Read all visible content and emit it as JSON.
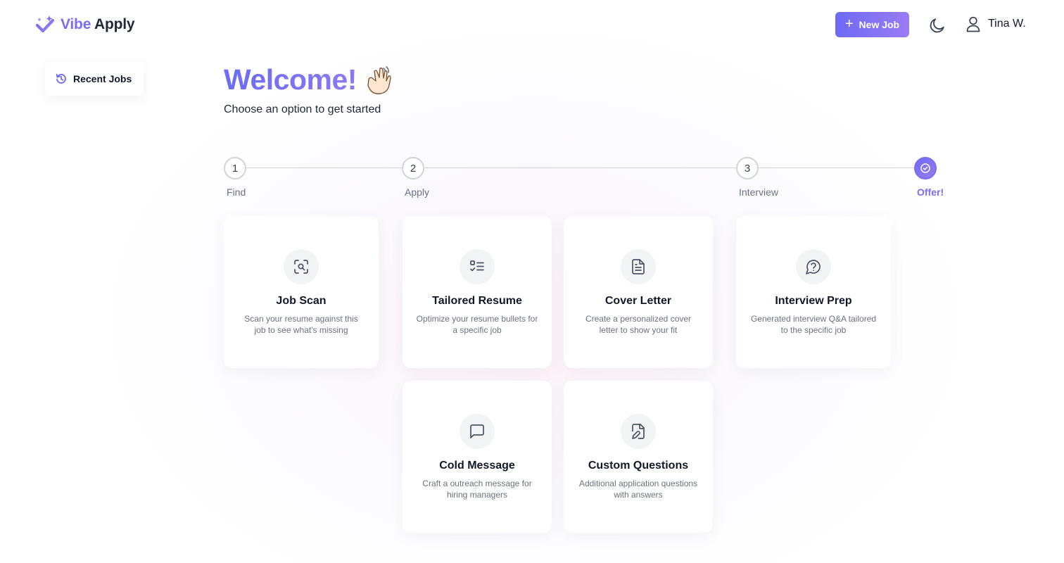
{
  "header": {
    "logo_vibe": "Vibe",
    "logo_apply": "Apply",
    "new_job_label": "New Job",
    "user_name": "Tina W."
  },
  "sidebar": {
    "recent_jobs_label": "Recent Jobs"
  },
  "main": {
    "title": "Welcome!",
    "subtitle": "Choose an option to get started"
  },
  "steps": [
    {
      "number": "1",
      "label": "Find"
    },
    {
      "number": "2",
      "label": "Apply"
    },
    {
      "number": "3",
      "label": "Interview"
    },
    {
      "number": "",
      "label": "Offer!",
      "active": true
    }
  ],
  "cards": [
    {
      "title": "Job Scan",
      "description": "Scan your resume against this job to see what's missing",
      "icon": "scan-search-icon"
    },
    {
      "title": "Tailored Resume",
      "description": "Optimize your resume bullets for a specific job",
      "icon": "list-check-icon"
    },
    {
      "title": "Cover Letter",
      "description": "Create a personalized cover letter to show your fit",
      "icon": "document-icon"
    },
    {
      "title": "Interview Prep",
      "description": "Generated interview Q&A tailored to the specific job",
      "icon": "question-bubble-icon"
    },
    {
      "title": "Cold Message",
      "description": "Craft a outreach message for hiring managers",
      "icon": "message-square-icon"
    },
    {
      "title": "Custom Questions",
      "description": "Additional application questions with answers",
      "icon": "file-pen-icon"
    }
  ],
  "colors": {
    "accent": "#7c6cf2",
    "accent_start": "#6d6af5",
    "accent_end": "#9a7cf4"
  }
}
